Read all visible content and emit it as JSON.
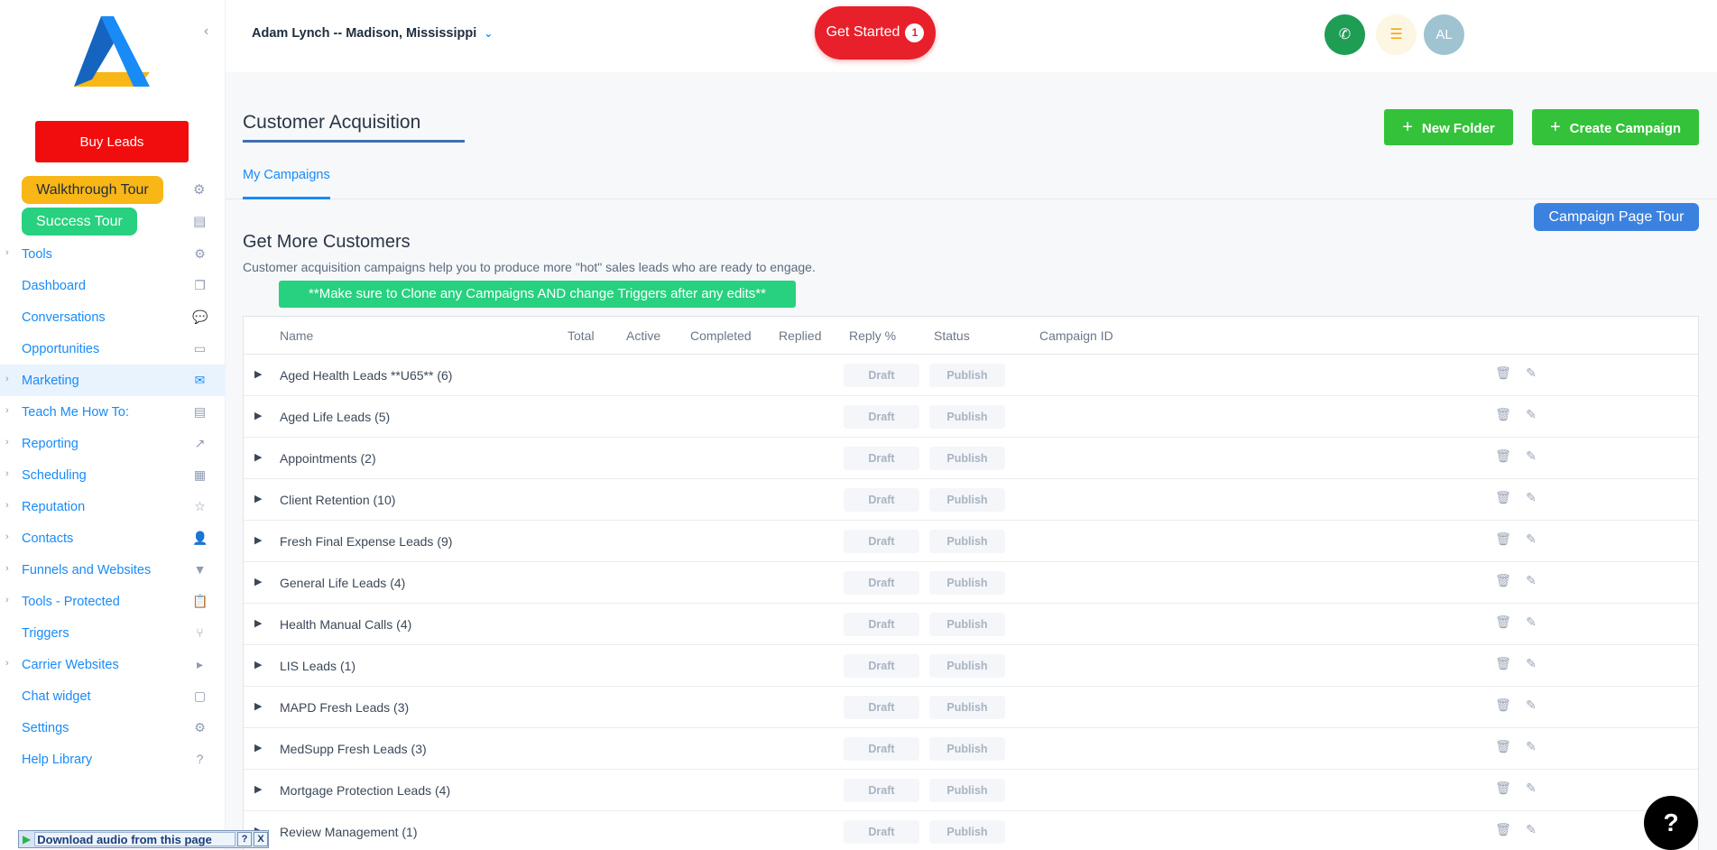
{
  "sidebar": {
    "buy_leads": "Buy Leads",
    "walkthrough_tour": "Walkthrough Tour",
    "success_tour": "Success Tour",
    "items": [
      {
        "label": "Tools",
        "chevron": true,
        "icon": "gears-icon"
      },
      {
        "label": "Dashboard",
        "chevron": false,
        "icon": "copy-icon"
      },
      {
        "label": "Conversations",
        "chevron": false,
        "icon": "chat-bubbles-icon"
      },
      {
        "label": "Opportunities",
        "chevron": false,
        "icon": "columns-icon"
      },
      {
        "label": "Marketing",
        "chevron": true,
        "icon": "mail-icon",
        "active": true
      },
      {
        "label": "Teach Me How To:",
        "chevron": true,
        "icon": "book-icon"
      },
      {
        "label": "Reporting",
        "chevron": true,
        "icon": "chart-icon"
      },
      {
        "label": "Scheduling",
        "chevron": true,
        "icon": "calendar-icon"
      },
      {
        "label": "Reputation",
        "chevron": true,
        "icon": "star-icon"
      },
      {
        "label": "Contacts",
        "chevron": true,
        "icon": "person-icon"
      },
      {
        "label": "Funnels and Websites",
        "chevron": true,
        "icon": "filter-icon"
      },
      {
        "label": "Tools - Protected",
        "chevron": true,
        "icon": "clipboard-icon"
      },
      {
        "label": "Triggers",
        "chevron": false,
        "icon": "branch-icon"
      },
      {
        "label": "Carrier Websites",
        "chevron": true,
        "icon": "play-box-icon"
      },
      {
        "label": "Chat widget",
        "chevron": false,
        "icon": "chat-icon"
      },
      {
        "label": "Settings",
        "chevron": false,
        "icon": "gear-icon"
      },
      {
        "label": "Help Library",
        "chevron": false,
        "icon": "question-circle-icon"
      }
    ]
  },
  "header": {
    "location": "Adam Lynch -- Madison, Mississippi",
    "get_started": "Get Started",
    "get_started_count": "1",
    "avatar_initials": "AL"
  },
  "main": {
    "title": "Customer Acquisition",
    "new_folder": "New Folder",
    "create_campaign": "Create Campaign",
    "tab": "My Campaigns",
    "page_tour": "Campaign Page Tour",
    "section_title": "Get More Customers",
    "section_subtitle": "Customer acquisition campaigns help you to produce more \"hot\" sales leads who are ready to engage.",
    "notice": "**Make sure to Clone any Campaigns AND change Triggers after any edits**"
  },
  "table": {
    "columns": [
      "Name",
      "Total",
      "Active",
      "Completed",
      "Replied",
      "Reply %",
      "Status",
      "Campaign ID"
    ],
    "draft_label": "Draft",
    "publish_label": "Publish",
    "rows": [
      {
        "name": "Aged Health Leads **U65** (6)"
      },
      {
        "name": "Aged Life Leads (5)"
      },
      {
        "name": "Appointments (2)"
      },
      {
        "name": "Client Retention (10)"
      },
      {
        "name": "Fresh Final Expense Leads (9)"
      },
      {
        "name": "General Life Leads (4)"
      },
      {
        "name": "Health Manual Calls (4)"
      },
      {
        "name": "LIS Leads (1)"
      },
      {
        "name": "MAPD Fresh Leads (3)"
      },
      {
        "name": "MedSupp Fresh Leads (3)"
      },
      {
        "name": "Mortgage Protection Leads (4)"
      },
      {
        "name": "Review Management (1)"
      }
    ]
  },
  "extras": {
    "help_fab": "?",
    "audio_bar": "Download audio from this page",
    "audio_help": "?",
    "audio_close": "X"
  },
  "colors": {
    "primary": "#188bf6",
    "buy_leads": "#f10d0d",
    "green_button": "#34c23a",
    "get_started": "#e8202b"
  }
}
